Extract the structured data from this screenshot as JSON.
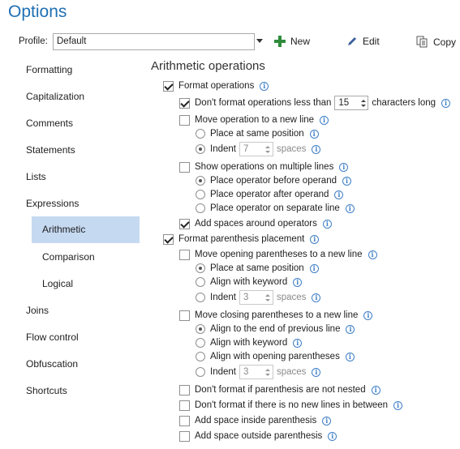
{
  "window": {
    "title": "Options"
  },
  "profile": {
    "label": "Profile:",
    "value": "Default"
  },
  "toolbar": {
    "new_label": "New",
    "edit_label": "Edit",
    "copy_label": "Copy"
  },
  "sidebar": {
    "items": [
      {
        "label": "Formatting"
      },
      {
        "label": "Capitalization"
      },
      {
        "label": "Comments"
      },
      {
        "label": "Statements"
      },
      {
        "label": "Lists"
      },
      {
        "label": "Expressions"
      },
      {
        "label": "Arithmetic",
        "selected": true
      },
      {
        "label": "Comparison"
      },
      {
        "label": "Logical"
      },
      {
        "label": "Joins"
      },
      {
        "label": "Flow control"
      },
      {
        "label": "Obfuscation"
      },
      {
        "label": "Shortcuts"
      }
    ]
  },
  "main": {
    "section_title": "Arithmetic operations",
    "format_operations": "Format operations",
    "dont_format_less_prefix": "Don't format operations less than",
    "dont_format_less_value": "15",
    "dont_format_less_suffix": "characters long",
    "move_operation_new_line": "Move operation to a new line",
    "place_same_position_1": "Place at same position",
    "indent_1": "Indent",
    "indent_1_value": "7",
    "indent_1_unit": "spaces",
    "show_multiple_lines": "Show operations on multiple lines",
    "place_before": "Place operator before operand",
    "place_after": "Place operator after operand",
    "place_separate": "Place operator on separate line",
    "add_spaces_operators": "Add spaces around operators",
    "format_parenthesis": "Format parenthesis placement",
    "move_opening_paren": "Move opening parentheses to a new line",
    "place_same_position_2": "Place at same position",
    "align_keyword_1": "Align with keyword",
    "indent_2": "Indent",
    "indent_2_value": "3",
    "indent_2_unit": "spaces",
    "move_closing_paren": "Move closing parentheses to a new line",
    "align_end_prev": "Align to the end of previous line",
    "align_keyword_2": "Align with keyword",
    "align_opening_paren": "Align with opening parentheses",
    "indent_3": "Indent",
    "indent_3_value": "3",
    "indent_3_unit": "spaces",
    "dont_format_not_nested": "Don't format if parenthesis are not nested",
    "dont_format_no_new_lines": "Don't format if there is no new lines in between",
    "add_space_inside": "Add space inside parenthesis",
    "add_space_outside": "Add space outside parenthesis"
  },
  "icons": {
    "info": "info-icon",
    "add": "plus-icon",
    "edit": "pencil-icon",
    "copy": "copy-icon"
  },
  "colors": {
    "accent": "#1f6fb2",
    "selected_bg": "#c5d9f1",
    "add_green": "#2e8b3a"
  }
}
